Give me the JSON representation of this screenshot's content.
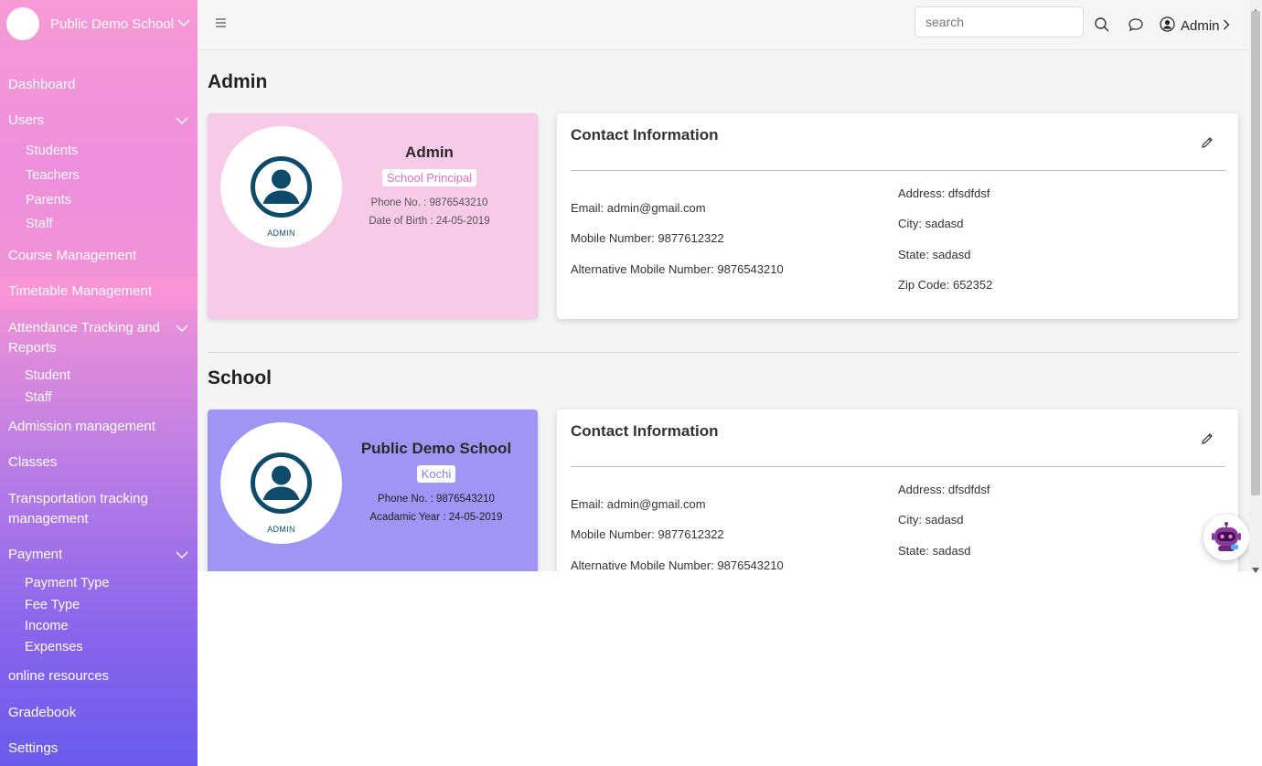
{
  "sidebar": {
    "brand": {
      "name": "Public Demo School"
    },
    "items": {
      "dashboard": "Dashboard",
      "users": "Users",
      "users_sub": [
        "Students",
        "Teachers",
        "Parents",
        "Staff"
      ],
      "course": "Course Management",
      "timetable": "Timetable Management",
      "attendance": "Attendance Tracking and Reports",
      "attendance_sub": [
        "Student",
        "Staff"
      ],
      "admission": "Admission management",
      "classes": "Classes",
      "transport": "Transportation tracking management",
      "payment": "Payment",
      "payment_sub": [
        "Payment Type",
        "Fee Type",
        "Income",
        "Expenses"
      ],
      "resources": "online resources",
      "gradebook": "Gradebook",
      "settings": "Settings"
    }
  },
  "header": {
    "search_placeholder": "search",
    "user_name": "Admin"
  },
  "admin_section": {
    "title": "Admin",
    "profile": {
      "avatar_caption": "ADMIN",
      "name": "Admin",
      "badge": "School Principal",
      "phone": "Phone No. : 9876543210",
      "dob": "Date of Birth : 24-05-2019"
    },
    "contact": {
      "title": "Contact Information",
      "email": "Email: admin@gmail.com",
      "mobile": "Mobile Number: 9877612322",
      "alt_mobile": "Alternative Mobile Number: 9876543210",
      "address": "Address: dfsdfdsf",
      "city": "City: sadasd",
      "state": "State: sadasd",
      "zip": "Zip Code: 652352"
    }
  },
  "school_section": {
    "title": "School",
    "profile": {
      "avatar_caption": "ADMIN",
      "name": "Public Demo School",
      "badge": "Kochi",
      "phone": "Phone No. : 9876543210",
      "year": "Acadamic Year : 24-05-2019"
    },
    "contact": {
      "title": "Contact Information",
      "email": "Email: admin@gmail.com",
      "mobile": "Mobile Number: 9877612322",
      "alt_mobile": "Alternative Mobile Number: 9876543210",
      "address": "Address: dfsdfdsf",
      "city": "City: sadasd",
      "state": "State: sadasd"
    }
  },
  "colors": {
    "admin_card": "#f7cbe7",
    "school_card": "#a095f5",
    "avatar_icon": "#0e4a6a"
  }
}
